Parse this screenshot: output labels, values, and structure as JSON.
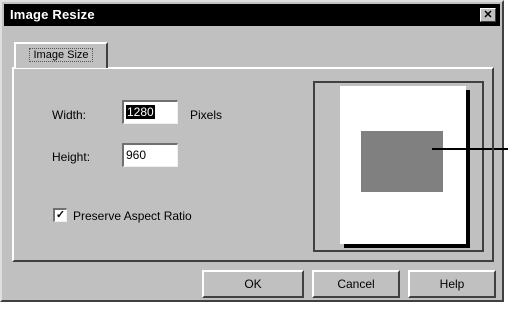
{
  "window": {
    "title": "Image Resize"
  },
  "tabs": [
    {
      "label": "Image Size",
      "active": true
    }
  ],
  "form": {
    "width_label": "Width:",
    "width_value": "1280",
    "width_unit": "Pixels",
    "height_label": "Height:",
    "height_value": "960",
    "preserve_label": "Preserve Aspect Ratio",
    "preserve_checked": true
  },
  "buttons": {
    "ok": "OK",
    "cancel": "Cancel",
    "help": "Help"
  },
  "icons": {
    "close": "close-icon",
    "checkmark": "checkmark-icon"
  },
  "colors": {
    "titlebar": "#000000",
    "face": "#c0c0c0",
    "preview_image": "#808080"
  }
}
